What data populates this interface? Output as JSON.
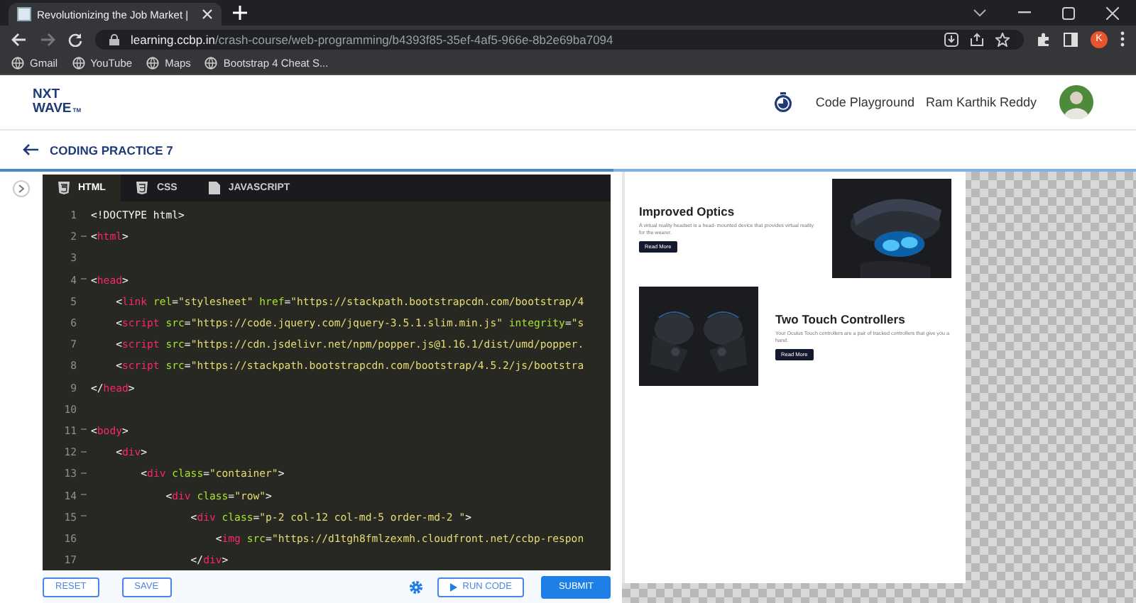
{
  "browser": {
    "tab_title": "Revolutionizing the Job Market |",
    "url_host": "learning.ccbp.in",
    "url_path": "/crash-course/web-programming/b4393f85-35ef-4af5-966e-8b2e69ba7094",
    "profile_initial": "K",
    "bookmarks": [
      "Gmail",
      "YouTube",
      "Maps",
      "Bootstrap 4 Cheat S..."
    ]
  },
  "header": {
    "logo_top": "NXT",
    "logo_bottom": "WAVE",
    "logo_tm": "TM",
    "playground": "Code Playground",
    "user_name": "Ram Karthik Reddy"
  },
  "practice_title": "CODING PRACTICE 7",
  "editor_tabs": [
    {
      "label": "HTML",
      "selected": true
    },
    {
      "label": "CSS",
      "selected": false
    },
    {
      "label": "JAVASCRIPT",
      "selected": false
    }
  ],
  "code_lines": [
    {
      "number": "1",
      "foldable": false,
      "tokens": [
        {
          "kind": "plain",
          "text": "<!DOCTYPE html>"
        }
      ]
    },
    {
      "number": "2",
      "foldable": true,
      "tokens": [
        {
          "kind": "plain",
          "text": "<"
        },
        {
          "kind": "tag",
          "text": "html"
        },
        {
          "kind": "plain",
          "text": ">"
        }
      ]
    },
    {
      "number": "3",
      "foldable": false
    },
    {
      "number": "4",
      "foldable": true,
      "tokens": [
        {
          "kind": "plain",
          "text": "<"
        },
        {
          "kind": "tag",
          "text": "head"
        },
        {
          "kind": "plain",
          "text": ">"
        }
      ]
    },
    {
      "number": "5",
      "foldable": false,
      "tokens": [
        {
          "kind": "plain",
          "text": "    <"
        },
        {
          "kind": "tag",
          "text": "link "
        },
        {
          "kind": "attr",
          "text": "rel"
        },
        {
          "kind": "plain",
          "text": "="
        },
        {
          "kind": "str",
          "text": "\"stylesheet\" "
        },
        {
          "kind": "attr",
          "text": "href"
        },
        {
          "kind": "plain",
          "text": "="
        },
        {
          "kind": "str",
          "text": "\"https://stackpath.bootstrapcdn.com/bootstrap/4"
        }
      ]
    },
    {
      "number": "6",
      "foldable": false,
      "tokens": [
        {
          "kind": "plain",
          "text": "    <"
        },
        {
          "kind": "tag",
          "text": "script "
        },
        {
          "kind": "attr",
          "text": "src"
        },
        {
          "kind": "plain",
          "text": "="
        },
        {
          "kind": "str",
          "text": "\"https://code.jquery.com/jquery-3.5.1.slim.min.js\" "
        },
        {
          "kind": "attr",
          "text": "integrity"
        },
        {
          "kind": "plain",
          "text": "="
        },
        {
          "kind": "str",
          "text": "\"s"
        }
      ]
    },
    {
      "number": "7",
      "foldable": false,
      "tokens": [
        {
          "kind": "plain",
          "text": "    <"
        },
        {
          "kind": "tag",
          "text": "script "
        },
        {
          "kind": "attr",
          "text": "src"
        },
        {
          "kind": "plain",
          "text": "="
        },
        {
          "kind": "str",
          "text": "\"https://cdn.jsdelivr.net/npm/popper.js@1.16.1/dist/umd/popper."
        }
      ]
    },
    {
      "number": "8",
      "foldable": false,
      "tokens": [
        {
          "kind": "plain",
          "text": "    <"
        },
        {
          "kind": "tag",
          "text": "script "
        },
        {
          "kind": "attr",
          "text": "src"
        },
        {
          "kind": "plain",
          "text": "="
        },
        {
          "kind": "str",
          "text": "\"https://stackpath.bootstrapcdn.com/bootstrap/4.5.2/js/bootstra"
        }
      ]
    },
    {
      "number": "9",
      "foldable": false,
      "tokens": [
        {
          "kind": "plain",
          "text": "</"
        },
        {
          "kind": "tag",
          "text": "head"
        },
        {
          "kind": "plain",
          "text": ">"
        }
      ]
    },
    {
      "number": "10",
      "foldable": false
    },
    {
      "number": "11",
      "foldable": true,
      "tokens": [
        {
          "kind": "plain",
          "text": "<"
        },
        {
          "kind": "tag",
          "text": "body"
        },
        {
          "kind": "plain",
          "text": ">"
        }
      ]
    },
    {
      "number": "12",
      "foldable": true,
      "tokens": [
        {
          "kind": "plain",
          "text": "    <"
        },
        {
          "kind": "tag",
          "text": "div"
        },
        {
          "kind": "plain",
          "text": ">"
        }
      ]
    },
    {
      "number": "13",
      "foldable": true,
      "tokens": [
        {
          "kind": "plain",
          "text": "        <"
        },
        {
          "kind": "tag",
          "text": "div "
        },
        {
          "kind": "attr",
          "text": "class"
        },
        {
          "kind": "plain",
          "text": "="
        },
        {
          "kind": "str",
          "text": "\"container\""
        },
        {
          "kind": "plain",
          "text": ">"
        }
      ]
    },
    {
      "number": "14",
      "foldable": true,
      "tokens": [
        {
          "kind": "plain",
          "text": "            <"
        },
        {
          "kind": "tag",
          "text": "div "
        },
        {
          "kind": "attr",
          "text": "class"
        },
        {
          "kind": "plain",
          "text": "="
        },
        {
          "kind": "str",
          "text": "\"row\""
        },
        {
          "kind": "plain",
          "text": ">"
        }
      ]
    },
    {
      "number": "15",
      "foldable": true,
      "tokens": [
        {
          "kind": "plain",
          "text": "                <"
        },
        {
          "kind": "tag",
          "text": "div "
        },
        {
          "kind": "attr",
          "text": "class"
        },
        {
          "kind": "plain",
          "text": "="
        },
        {
          "kind": "str",
          "text": "\"p-2 col-12 col-md-5 order-md-2 \""
        },
        {
          "kind": "plain",
          "text": ">"
        }
      ]
    },
    {
      "number": "16",
      "foldable": false,
      "tokens": [
        {
          "kind": "plain",
          "text": "                    <"
        },
        {
          "kind": "tag",
          "text": "img "
        },
        {
          "kind": "attr",
          "text": "src"
        },
        {
          "kind": "plain",
          "text": "="
        },
        {
          "kind": "str",
          "text": "\"https://d1tgh8fmlzexmh.cloudfront.net/ccbp-respon"
        }
      ]
    },
    {
      "number": "17",
      "foldable": false,
      "tokens": [
        {
          "kind": "plain",
          "text": "                </"
        },
        {
          "kind": "tag",
          "text": "div"
        },
        {
          "kind": "plain",
          "text": ">"
        }
      ]
    }
  ],
  "editor_buttons": {
    "reset": "RESET",
    "save": "SAVE",
    "run": "RUN CODE",
    "submit": "SUBMIT"
  },
  "preview_cards": [
    {
      "title": "Improved Optics",
      "text": "A virtual reality headset is a head- mounted device that provides virtual reality for the wearer.",
      "button": "Read More",
      "kind": "image_right"
    },
    {
      "title": "Two Touch Controllers",
      "text": "Your Oculus Touch controllers are a pair of tracked controllers that give you a hand.",
      "button": "Read More",
      "kind": "image_left"
    }
  ]
}
